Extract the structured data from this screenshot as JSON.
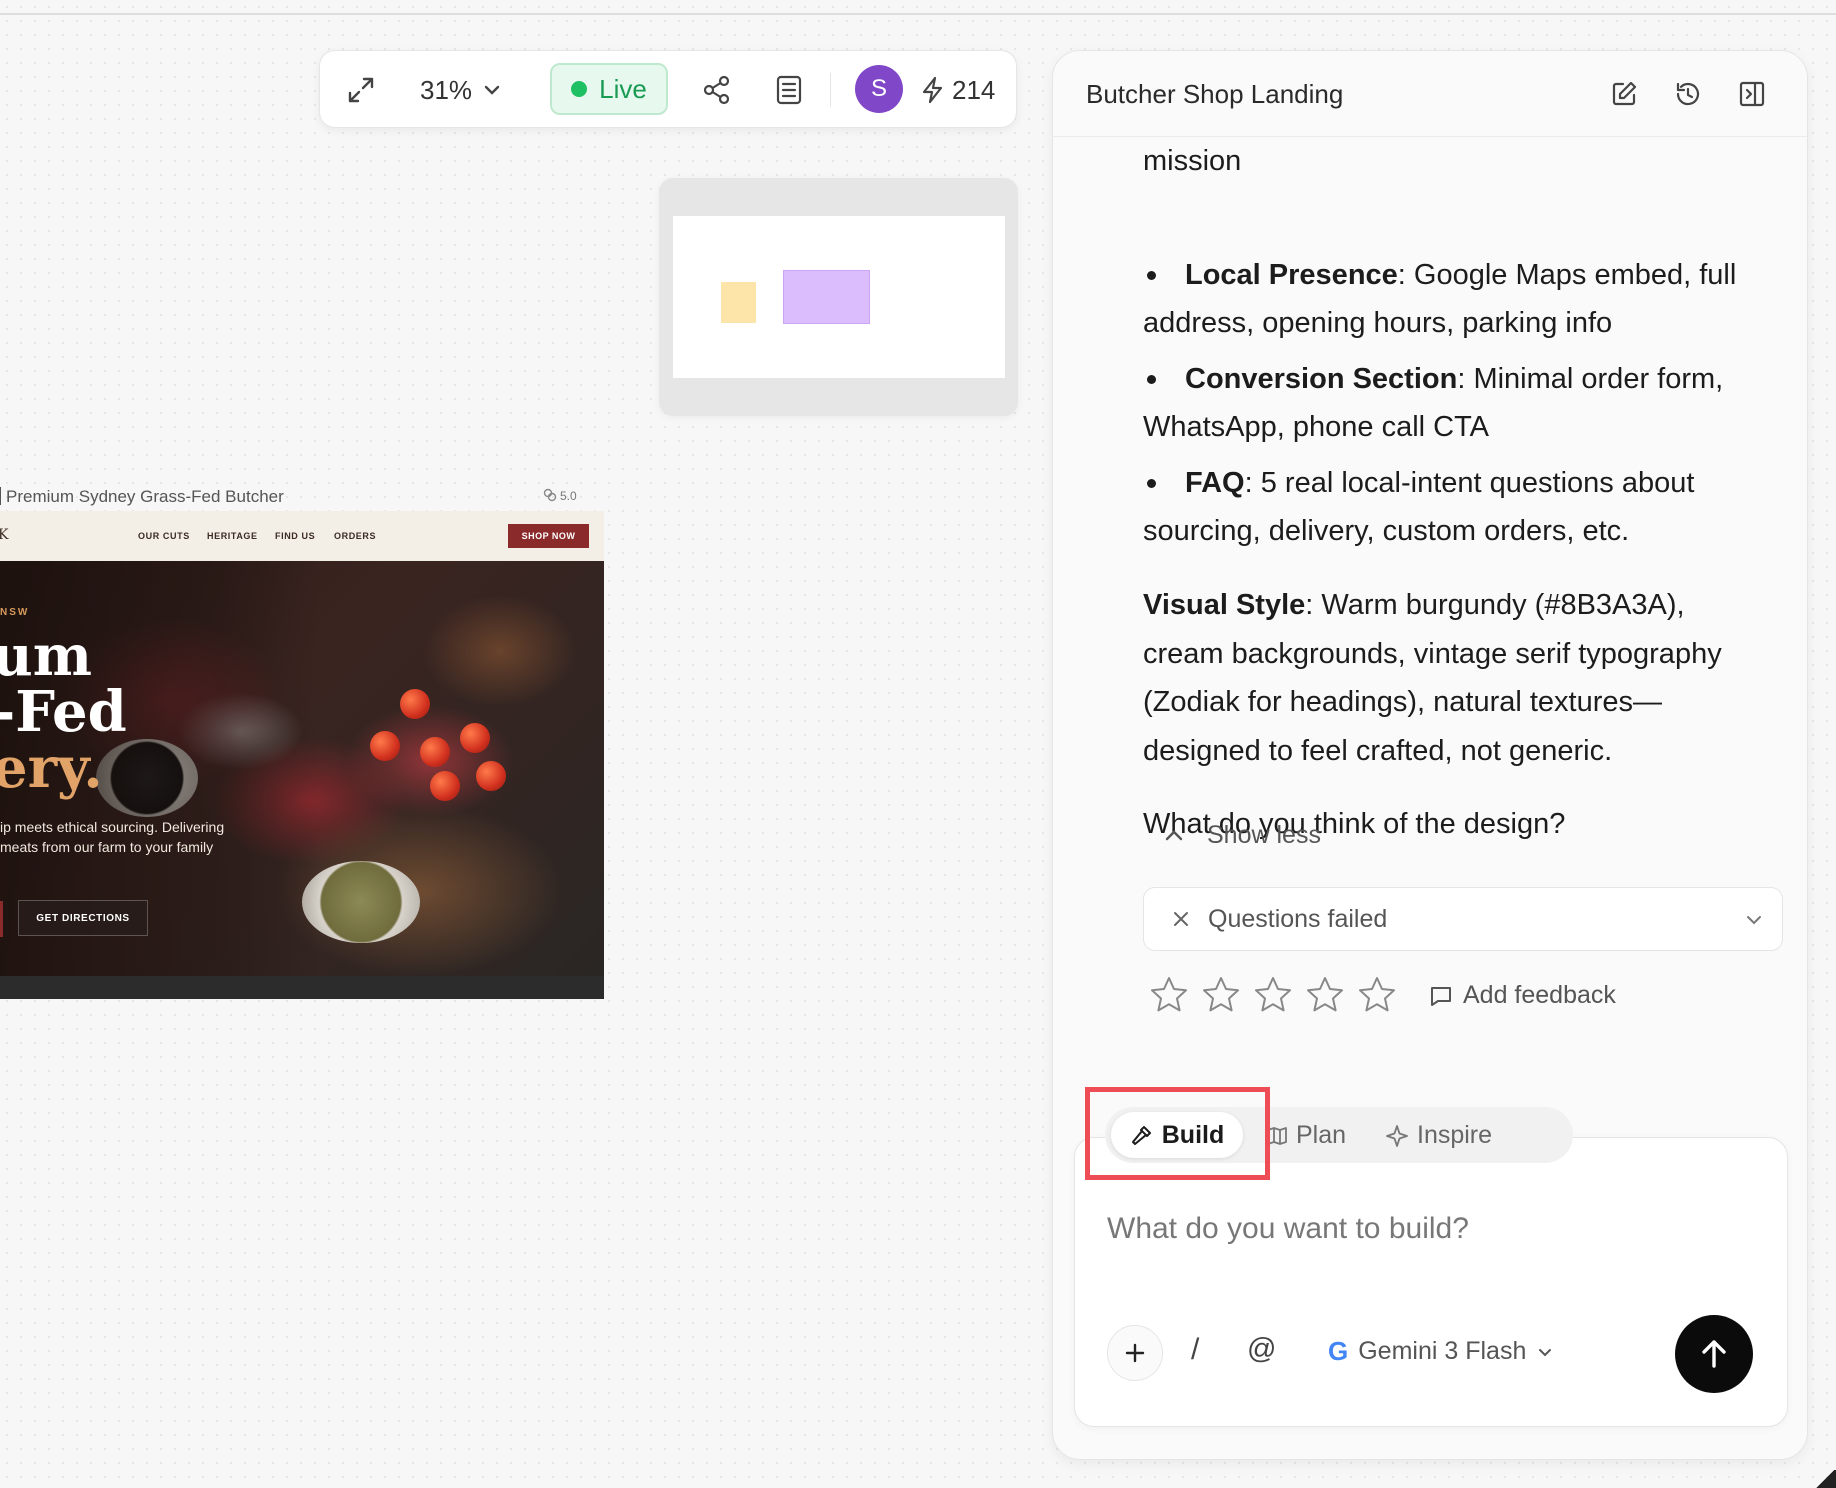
{
  "toolbar": {
    "zoom": "31%",
    "live_label": "Live",
    "avatar_initial": "S",
    "credits": "214"
  },
  "preview": {
    "frame_label": "Premium Sydney Grass-Fed Butcher",
    "version": "5.0",
    "nav": {
      "logo_fragment": "K",
      "links": [
        "OUR CUTS",
        "HERITAGE",
        "FIND US",
        "ORDERS"
      ],
      "cta": "SHOP NOW"
    },
    "hero": {
      "kicker": "NSW",
      "headline_1": "um",
      "headline_2": "-Fed",
      "headline_3": "ery.",
      "paragraph": "ip meets ethical sourcing. Delivering meats from our farm to your family",
      "button": "GET DIRECTIONS"
    }
  },
  "panel": {
    "title": "Butcher Shop Landing",
    "message": {
      "line_mission": "mission",
      "bullet_1_bold": "Local Presence",
      "bullet_1_rest": ": Google Maps embed, full",
      "bullet_1_cont": "address, opening hours, parking info",
      "bullet_2_bold": "Conversion Section",
      "bullet_2_rest": ": Minimal order form,",
      "bullet_2_cont": "WhatsApp, phone call CTA",
      "bullet_3_bold": "FAQ",
      "bullet_3_rest": ": 5 real local-intent questions about",
      "bullet_3_cont": "sourcing, delivery, custom orders, etc.",
      "style_bold": "Visual Style",
      "style_rest": ": Warm burgundy (#8B3A3A),",
      "style_2": "cream backgrounds, vintage serif typography",
      "style_3": "(Zodiak for headings), natural textures—",
      "style_4": "designed to feel crafted, not generic.",
      "question": "What do you think of the design?"
    },
    "show_less": "Show less",
    "questions_failed": "Questions failed",
    "rating_stars": 0,
    "add_feedback": "Add feedback",
    "composer": {
      "modes": [
        "Build",
        "Plan",
        "Inspire"
      ],
      "active_mode": "Build",
      "placeholder": "What do you want to build?",
      "slash": "/",
      "at": "@",
      "model": "Gemini 3 Flash",
      "google_g": "G"
    }
  },
  "colors": {
    "live_green": "#1fbf63",
    "avatar_purple": "#8147c9",
    "burgundy": "#8b2a2a",
    "highlight_red": "#ef4d56"
  }
}
